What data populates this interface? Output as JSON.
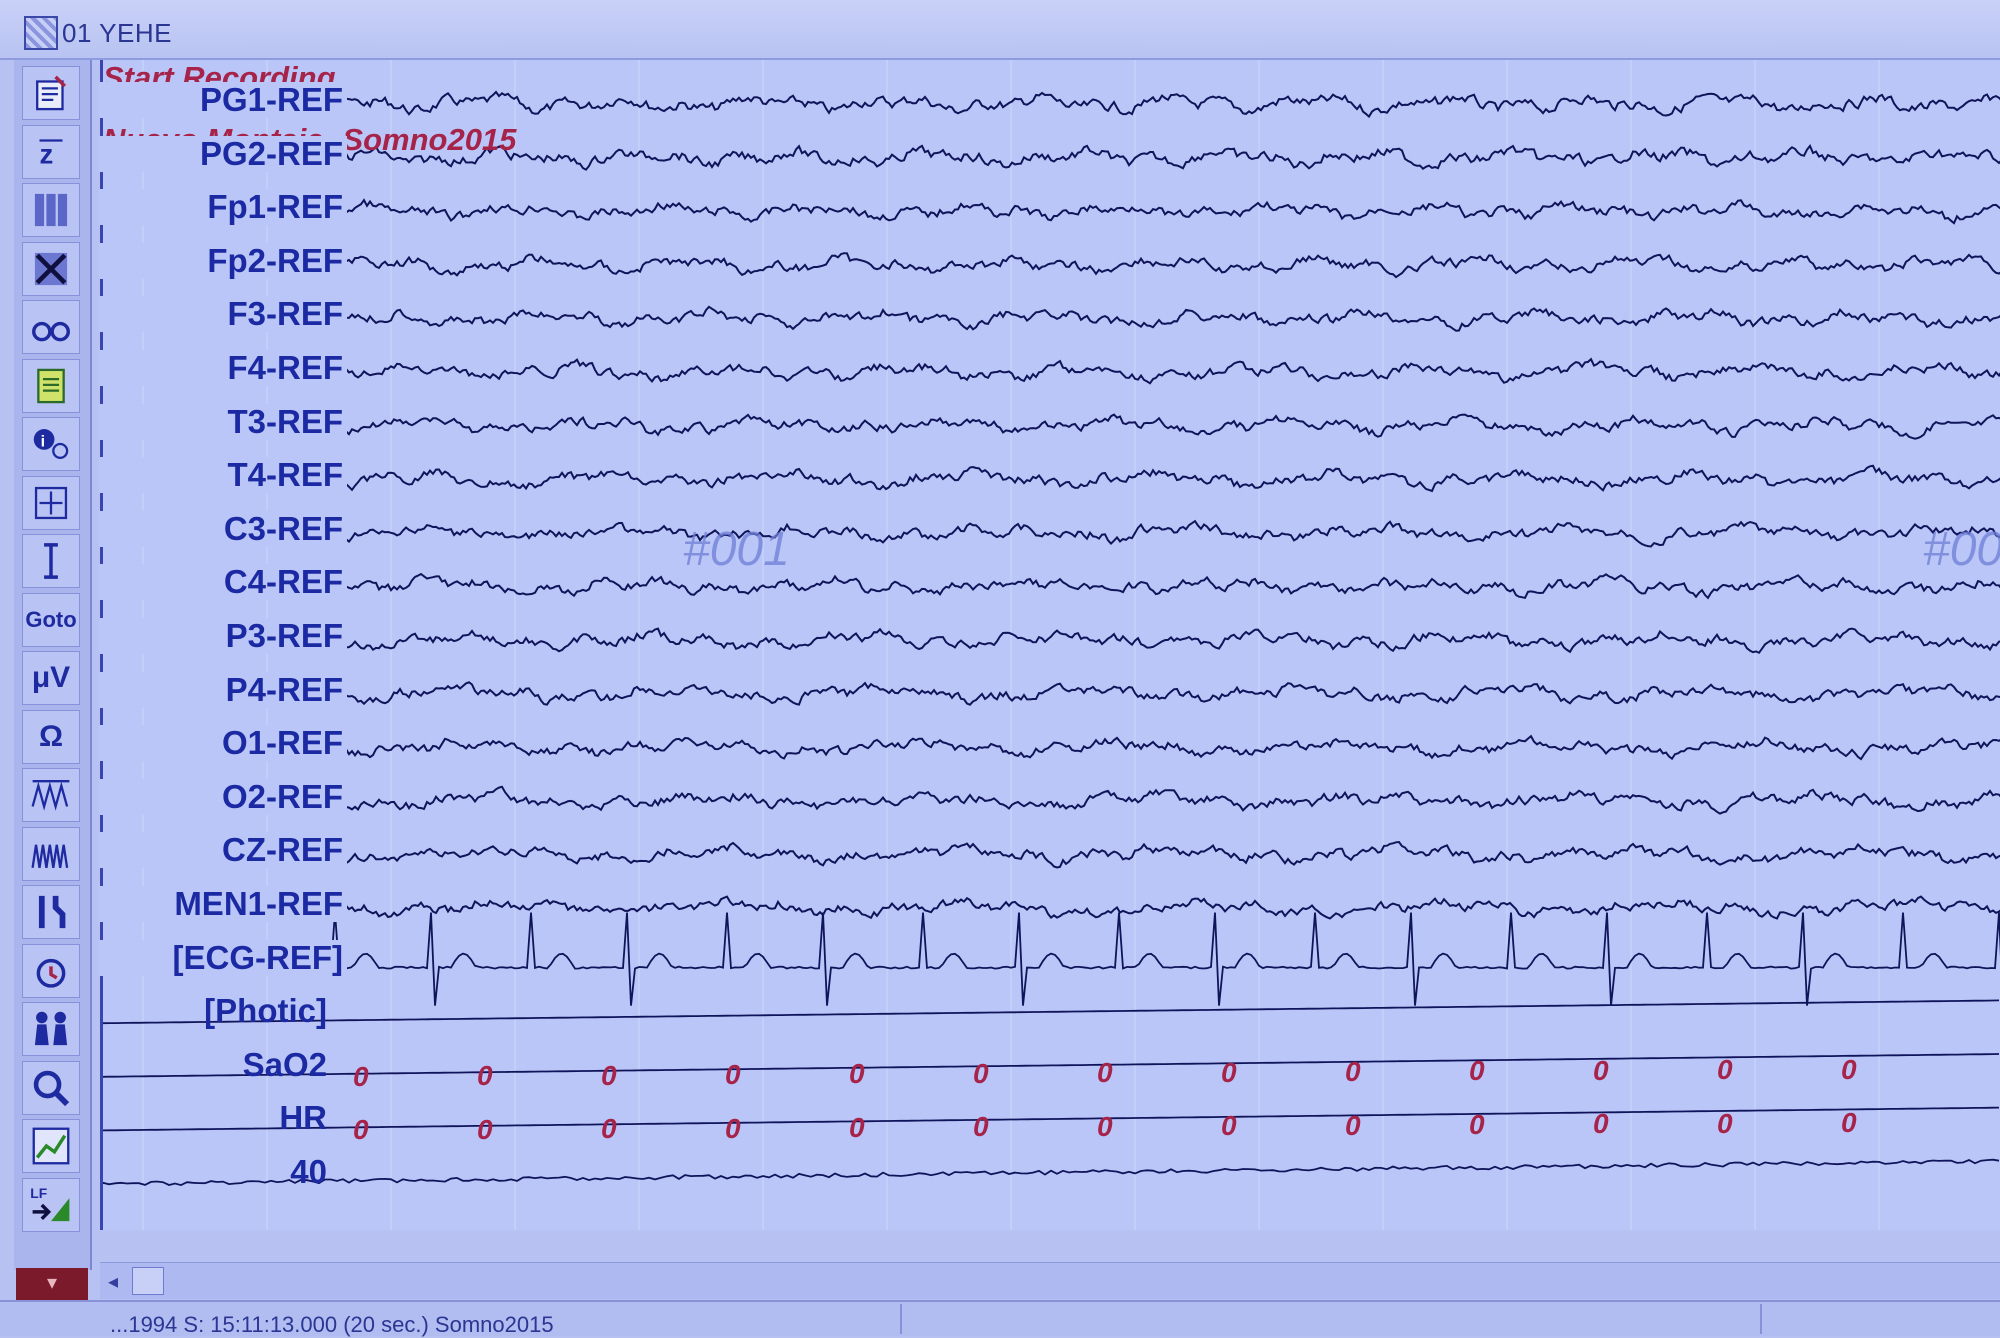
{
  "window": {
    "title": "01 YEHE"
  },
  "toolbar": {
    "tools": [
      {
        "name": "document-edit-icon"
      },
      {
        "name": "sort-z-icon"
      },
      {
        "name": "columns-icon"
      },
      {
        "name": "cut-icon"
      },
      {
        "name": "glasses-icon"
      },
      {
        "name": "notes-icon"
      },
      {
        "name": "patient-info-icon"
      },
      {
        "name": "move-icon"
      },
      {
        "name": "text-cursor-icon"
      },
      {
        "name": "goto-button",
        "label": "Goto"
      },
      {
        "name": "microvolt-icon",
        "label": "μV"
      },
      {
        "name": "ohm-icon",
        "label": "Ω"
      },
      {
        "name": "wave-expand-icon"
      },
      {
        "name": "wave-compress-icon"
      },
      {
        "name": "tools-icon"
      },
      {
        "name": "alarm-icon"
      },
      {
        "name": "people-icon"
      },
      {
        "name": "search-icon"
      },
      {
        "name": "trend-chart-icon"
      },
      {
        "name": "lf-filter-icon",
        "label": "LF"
      }
    ],
    "menu_arrow": "▾"
  },
  "annotations": {
    "start_recording": "Start Recording",
    "montage": "Nuevo Montaje -Somno2015",
    "page_marker": "#001",
    "page_marker_next": "#00"
  },
  "channels": [
    "PG1-REF",
    "PG2-REF",
    "Fp1-REF",
    "Fp2-REF",
    "F3-REF",
    "F4-REF",
    "T3-REF",
    "T4-REF",
    "C3-REF",
    "C4-REF",
    "P3-REF",
    "P4-REF",
    "O1-REF",
    "O2-REF",
    "CZ-REF",
    "MEN1-REF",
    "[ECG-REF]",
    "[Photic]",
    "SaO2",
    "HR",
    "40"
  ],
  "value_readouts": {
    "sao2_value": "0",
    "hr_value": "0"
  },
  "status": {
    "text": "...1994 S: 15:11:13.000 (20 sec.) Somno2015"
  },
  "colors": {
    "background": "#bac6f7",
    "trace": "#10145a",
    "channel_label": "#1b2aa3",
    "annotation": "#a6234a"
  }
}
